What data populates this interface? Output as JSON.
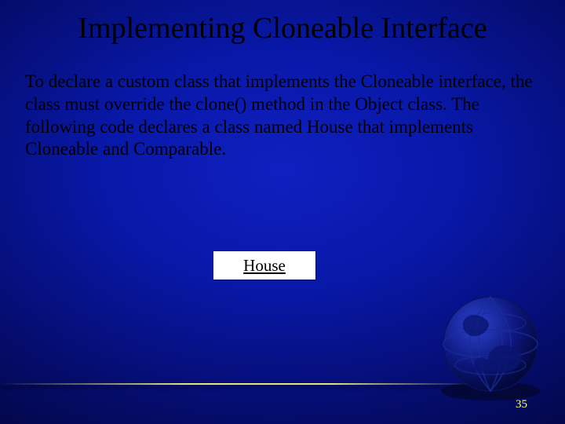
{
  "slide": {
    "title": "Implementing Cloneable Interface",
    "body": "To declare a custom class that implements the Cloneable interface, the class must override the clone() method in the Object class. The following code declares a class named House that implements Cloneable and Comparable.",
    "button_label": "House",
    "page_number": "35"
  }
}
